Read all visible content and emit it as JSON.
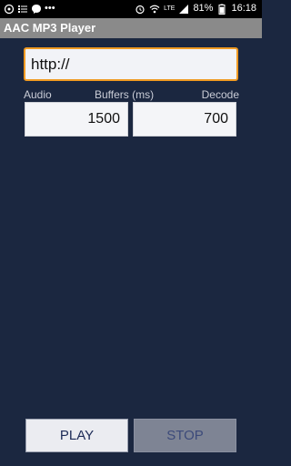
{
  "status_bar": {
    "battery": "81%",
    "time": "16:18",
    "network": "LTE",
    "icons_left": [
      "location-icon",
      "list-icon",
      "messenger-icon",
      "more-dots-icon"
    ],
    "icons_right": [
      "alarm-icon",
      "wifi-icon",
      "signal-icon",
      "battery-icon"
    ]
  },
  "app": {
    "title": "AAC MP3 Player"
  },
  "url": {
    "value": "http://"
  },
  "labels": {
    "audio": "Audio",
    "buffers": "Buffers (ms)",
    "decode": "Decode"
  },
  "buffers": {
    "audio": "1500",
    "decode": "700"
  },
  "buttons": {
    "play": "PLAY",
    "stop": "STOP"
  },
  "colors": {
    "background": "#1b2740",
    "accent_focus": "#f09a22",
    "titlebar": "#8a8a8a"
  }
}
